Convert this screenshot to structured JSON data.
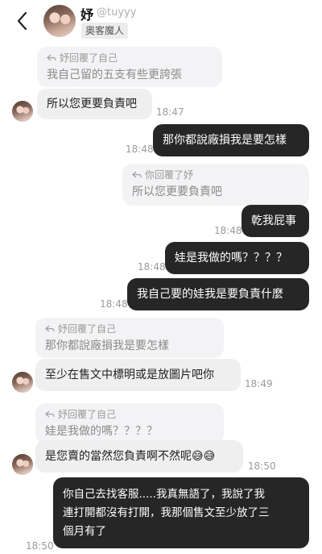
{
  "header": {
    "name": "妤",
    "handle": "@tuyyy",
    "badge": "奧客魔人"
  },
  "messages": {
    "m1": {
      "reply_label": "妤回覆了自己",
      "quoted": "我自己留的五支有些更誇張",
      "text": "所以您更要負責吧",
      "time": "18:47"
    },
    "m2": {
      "text": "那你都說廠損我是要怎樣",
      "time": "18:48"
    },
    "m3": {
      "reply_label": "你回覆了妤",
      "quoted": "所以您更要負責吧",
      "text": "乾我屁事",
      "time": "18:48"
    },
    "m4": {
      "text": "娃是我做的嗎？？？？",
      "time": "18:48"
    },
    "m5": {
      "text": "我自己要的娃我是要負責什麼",
      "time": "18:48"
    },
    "m6": {
      "reply_label": "妤回覆了自己",
      "quoted": "那你都說廠損我是要怎樣",
      "text": "至少在售文中標明或是放圖片吧你",
      "time": "18:49"
    },
    "m7": {
      "reply_label": "妤回覆了自己",
      "quoted": "娃是我做的嗎？？？？",
      "text": "是您賣的當然您負責啊不然呢😅😅",
      "time": "18:50"
    },
    "m8": {
      "line1": "你自己去找客服.....我真無語了，我說了我",
      "line2": "連打開都沒有打開，我那個售文至少放了三",
      "line3": "個月有了",
      "time": "18:50"
    }
  }
}
